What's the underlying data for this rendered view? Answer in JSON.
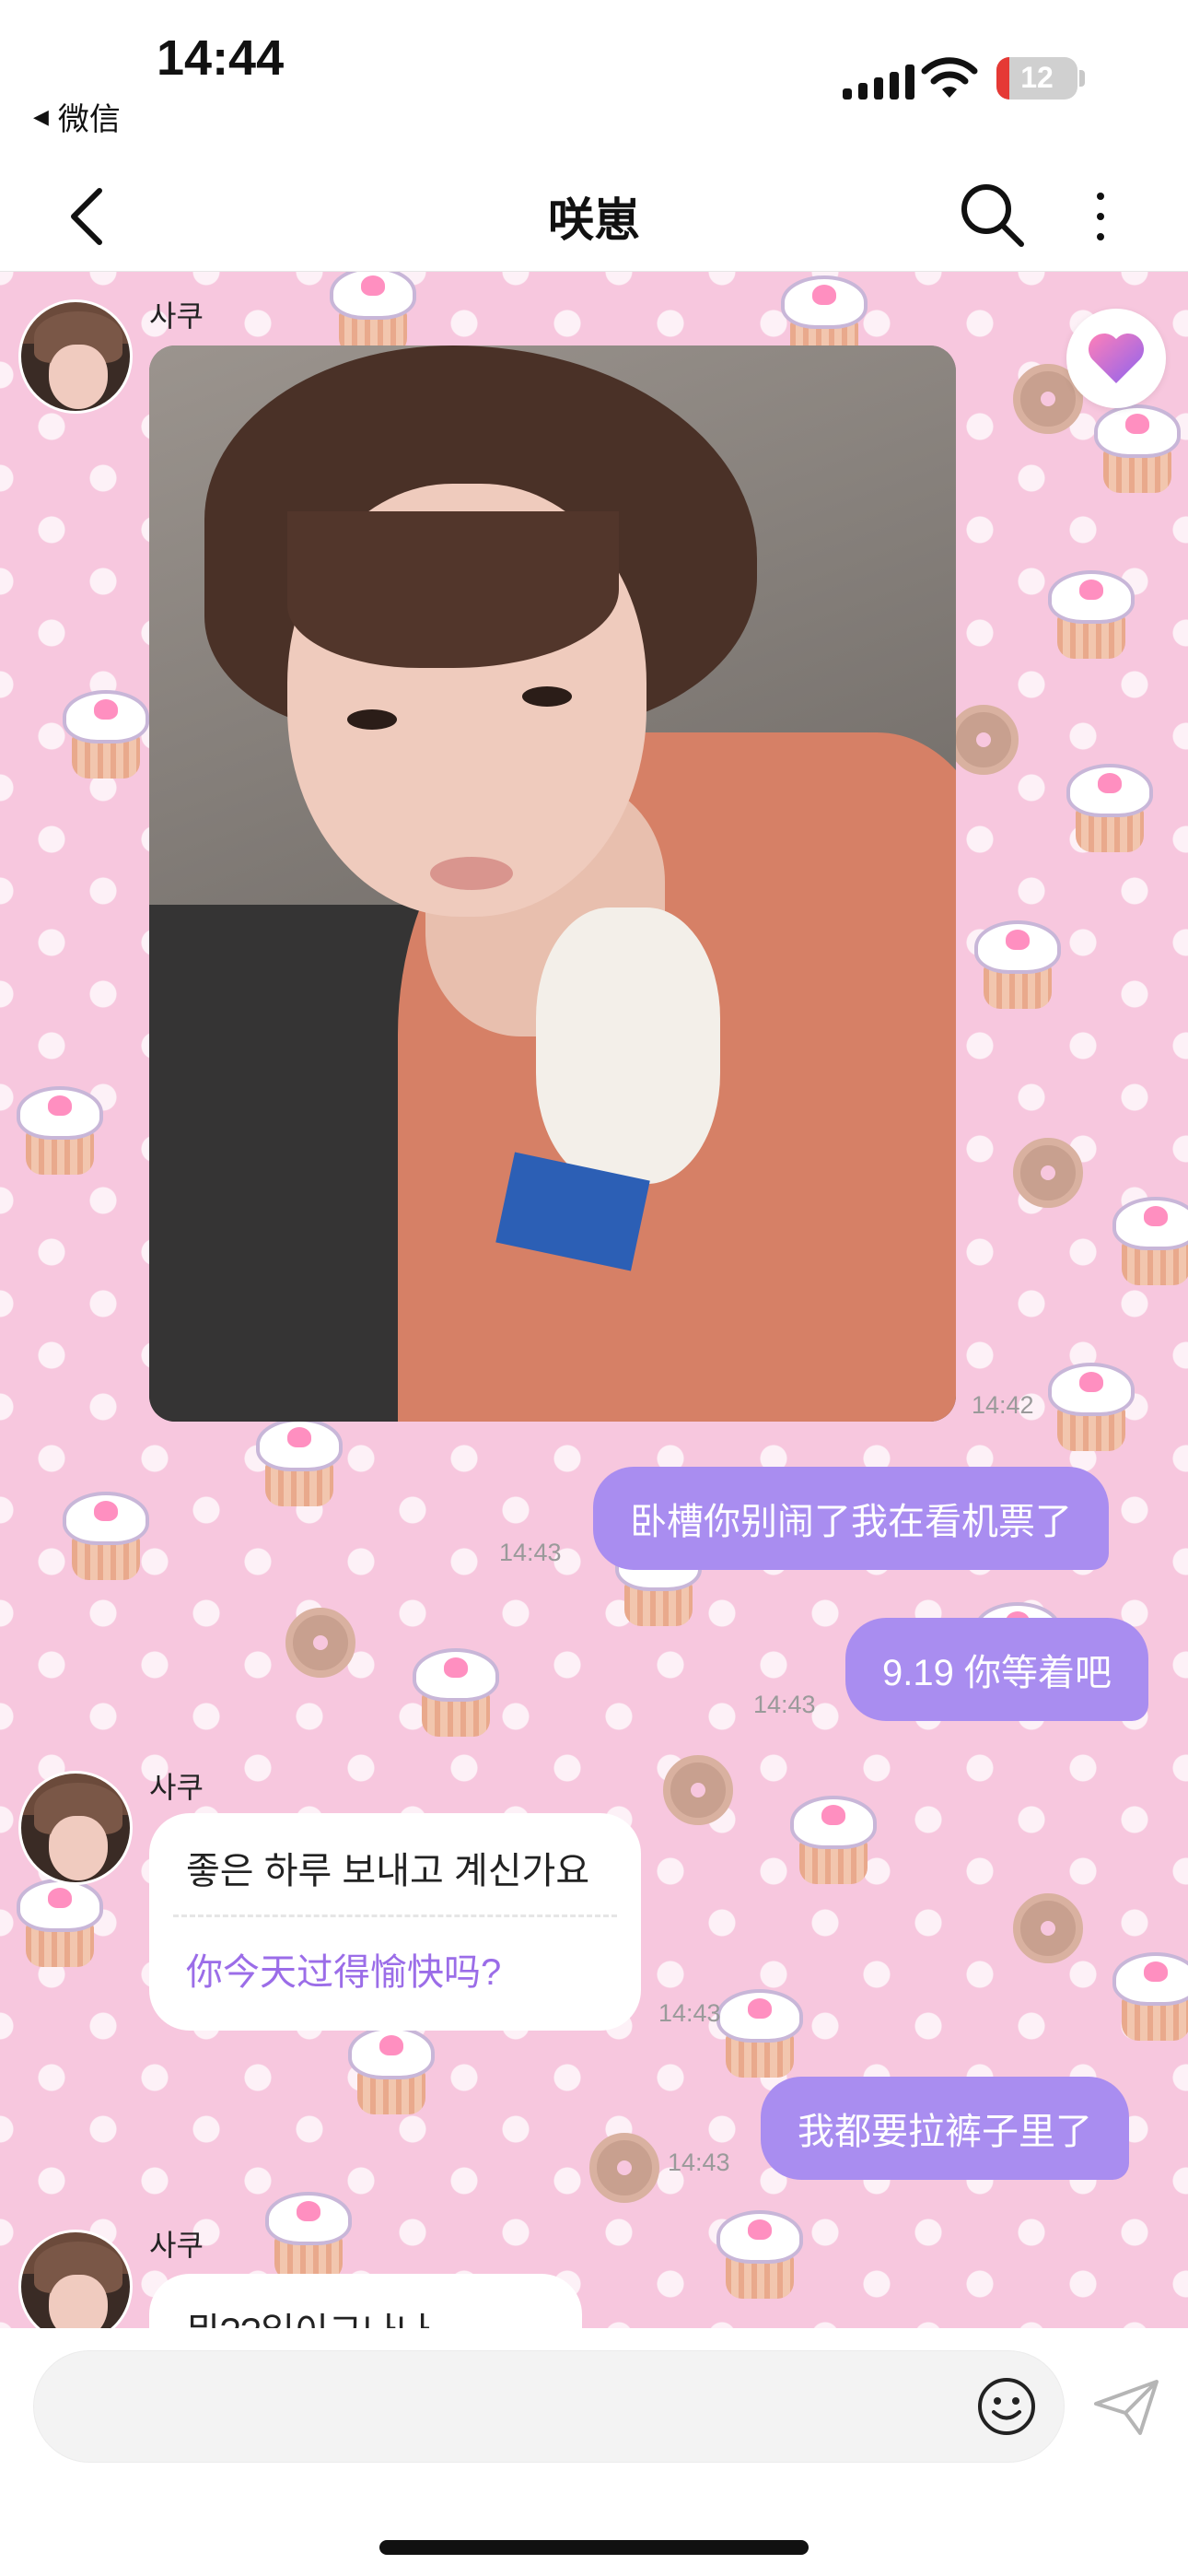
{
  "status_bar": {
    "time": "14:44",
    "back_app": "微信",
    "battery": "12"
  },
  "header": {
    "title": "咲崽"
  },
  "messages": [
    {
      "sender": "사쿠",
      "type": "photo",
      "time": "14:42"
    },
    {
      "type": "text_out",
      "text": "卧槽你别闹了我在看机票了",
      "time": "14:43"
    },
    {
      "type": "text_out",
      "text": "9.19 你等着吧",
      "time": "14:43"
    },
    {
      "sender": "사쿠",
      "type": "text_in",
      "text": "좋은 하루 보내고 계신가요",
      "translation": "你今天过得愉快吗?",
      "time": "14:43"
    },
    {
      "type": "text_out",
      "text": "我都要拉裤子里了",
      "time": "14:43"
    },
    {
      "sender": "사쿠",
      "type": "text_in",
      "text": "뭐??일이그나나"
    }
  ],
  "colors": {
    "chat_background": "#f7c7de",
    "outgoing_bubble": "#a98df0",
    "translation_text": "#9b6de8"
  },
  "icons": [
    "back-icon",
    "search-icon",
    "more-icon",
    "heart-icon",
    "emoji-icon",
    "send-icon"
  ]
}
